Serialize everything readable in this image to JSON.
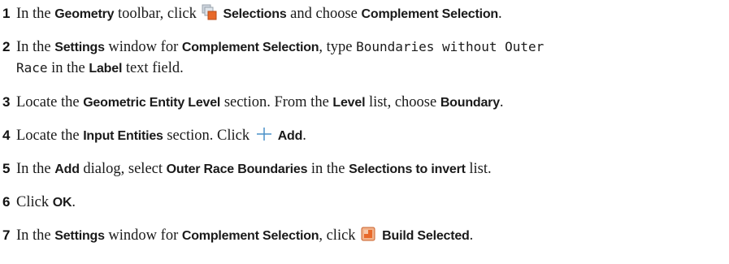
{
  "steps": [
    {
      "number": "1",
      "parts": [
        {
          "t": "In the "
        },
        {
          "t": "Geometry",
          "b": true
        },
        {
          "t": " toolbar, click "
        },
        {
          "icon": "selections-icon"
        },
        {
          "t": "Selections",
          "b": true
        },
        {
          "t": " and choose "
        },
        {
          "t": "Complement Selection",
          "b": true
        },
        {
          "t": "."
        }
      ]
    },
    {
      "number": "2",
      "parts": [
        {
          "t": "In the "
        },
        {
          "t": "Settings",
          "b": true
        },
        {
          "t": " window for "
        },
        {
          "t": "Complement Selection",
          "b": true
        },
        {
          "t": ", type "
        },
        {
          "t": "Boundaries without Outer",
          "m": true
        }
      ],
      "continuation": [
        {
          "t": "Race",
          "m": true
        },
        {
          "t": " in the "
        },
        {
          "t": "Label",
          "b": true
        },
        {
          "t": " text field."
        }
      ]
    },
    {
      "number": "3",
      "parts": [
        {
          "t": "Locate the "
        },
        {
          "t": "Geometric Entity Level",
          "b": true
        },
        {
          "t": " section. From the "
        },
        {
          "t": "Level",
          "b": true
        },
        {
          "t": " list, choose "
        },
        {
          "t": "Boundary",
          "b": true
        },
        {
          "t": "."
        }
      ]
    },
    {
      "number": "4",
      "parts": [
        {
          "t": "Locate the "
        },
        {
          "t": "Input Entities",
          "b": true
        },
        {
          "t": " section. Click "
        },
        {
          "icon": "plus-icon"
        },
        {
          "t": "Add",
          "b": true
        },
        {
          "t": "."
        }
      ]
    },
    {
      "number": "5",
      "parts": [
        {
          "t": "In the "
        },
        {
          "t": "Add",
          "b": true
        },
        {
          "t": " dialog, select "
        },
        {
          "t": "Outer Race Boundaries",
          "b": true
        },
        {
          "t": " in the "
        },
        {
          "t": "Selections to invert",
          "b": true
        },
        {
          "t": " list."
        }
      ]
    },
    {
      "number": "6",
      "parts": [
        {
          "t": "Click "
        },
        {
          "t": "OK",
          "b": true
        },
        {
          "t": "."
        }
      ]
    },
    {
      "number": "7",
      "parts": [
        {
          "t": "In the "
        },
        {
          "t": "Settings",
          "b": true
        },
        {
          "t": " window for "
        },
        {
          "t": "Complement Selection",
          "b": true
        },
        {
          "t": ", click "
        },
        {
          "icon": "build-selected-icon"
        },
        {
          "t": "Build Selected",
          "b": true
        },
        {
          "t": "."
        }
      ]
    }
  ],
  "colors": {
    "accent_blue": "#4a90c8",
    "icon_orange": "#e8692a",
    "icon_gray": "#9aa3ad"
  }
}
